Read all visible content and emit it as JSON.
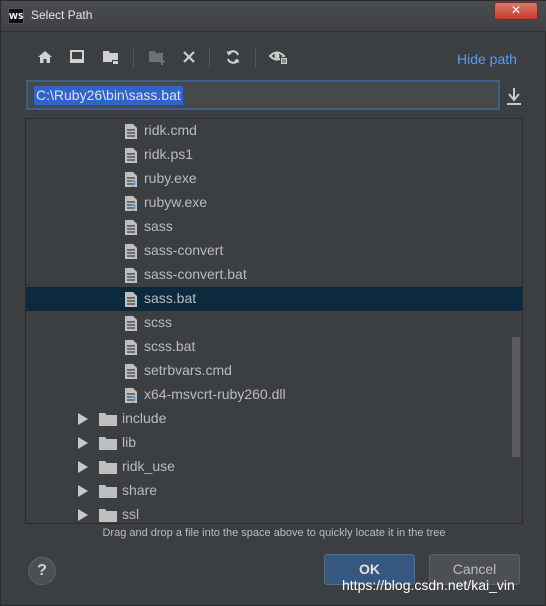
{
  "window": {
    "app_icon_text": "WS",
    "title": "Select Path",
    "close_glyph": "✕"
  },
  "toolbar": {
    "buttons": [
      "home-icon",
      "desktop-icon",
      "project-folder-icon",
      "new-folder-icon",
      "delete-icon",
      "refresh-icon",
      "show-hidden-icon"
    ],
    "hide_path_label": "Hide path"
  },
  "path_field": {
    "value": "C:\\Ruby26\\bin\\sass.bat"
  },
  "tree": {
    "files": [
      {
        "name": "ridk.cmd",
        "icon": "text-file-icon"
      },
      {
        "name": "ridk.ps1",
        "icon": "text-file-icon"
      },
      {
        "name": "ruby.exe",
        "icon": "unknown-file-icon"
      },
      {
        "name": "rubyw.exe",
        "icon": "unknown-file-icon"
      },
      {
        "name": "sass",
        "icon": "text-file-icon"
      },
      {
        "name": "sass-convert",
        "icon": "text-file-icon"
      },
      {
        "name": "sass-convert.bat",
        "icon": "text-file-icon"
      },
      {
        "name": "sass.bat",
        "icon": "text-file-icon",
        "selected": true
      },
      {
        "name": "scss",
        "icon": "text-file-icon"
      },
      {
        "name": "scss.bat",
        "icon": "text-file-icon"
      },
      {
        "name": "setrbvars.cmd",
        "icon": "text-file-icon"
      },
      {
        "name": "x64-msvcrt-ruby260.dll",
        "icon": "unknown-file-icon"
      }
    ],
    "folders": [
      {
        "name": "include"
      },
      {
        "name": "lib"
      },
      {
        "name": "ridk_use"
      },
      {
        "name": "share"
      },
      {
        "name": "ssl"
      }
    ]
  },
  "hint": "Drag and drop a file into the space above to quickly locate it in the tree",
  "footer": {
    "help_label": "?",
    "ok_label": "OK",
    "cancel_label": "Cancel"
  },
  "watermark": "https://blog.csdn.net/kai_vin",
  "colors": {
    "background": "#3c3f41",
    "accent": "#589df6",
    "selection": "#0d293e",
    "path_selection": "#2f65ca"
  }
}
